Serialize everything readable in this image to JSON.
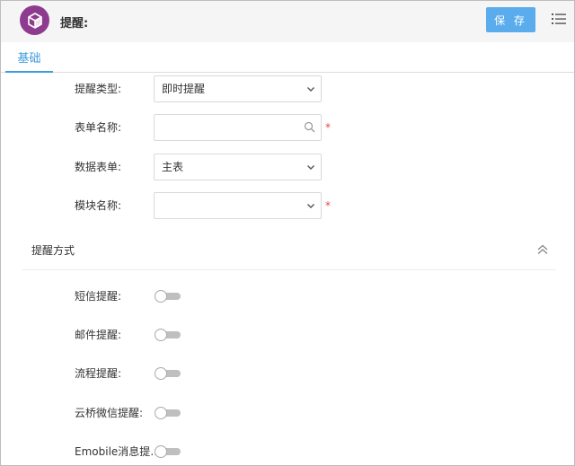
{
  "header": {
    "title": "提醒:",
    "save_label": "保 存",
    "logo_icon": "cube-icon",
    "menu_icon": "list-menu-icon",
    "logo_color": "#8e3b8f",
    "accent_color": "#5aacec"
  },
  "tabs": [
    {
      "label": "基础",
      "active": true
    }
  ],
  "form": {
    "reminder_type": {
      "label": "提醒类型:",
      "value": "即时提醒"
    },
    "form_name": {
      "label": "表单名称:",
      "value": "",
      "required_mark": "*"
    },
    "data_form": {
      "label": "数据表单:",
      "value": "主表"
    },
    "module_name": {
      "label": "模块名称:",
      "value": "",
      "required_mark": "*"
    }
  },
  "section": {
    "title": "提醒方式"
  },
  "methods": [
    {
      "label": "短信提醒:",
      "enabled": false
    },
    {
      "label": "邮件提醒:",
      "enabled": false
    },
    {
      "label": "流程提醒:",
      "enabled": false
    },
    {
      "label": "云桥微信提醒:",
      "enabled": false
    },
    {
      "label": "Emobile消息提…",
      "enabled": false
    }
  ]
}
